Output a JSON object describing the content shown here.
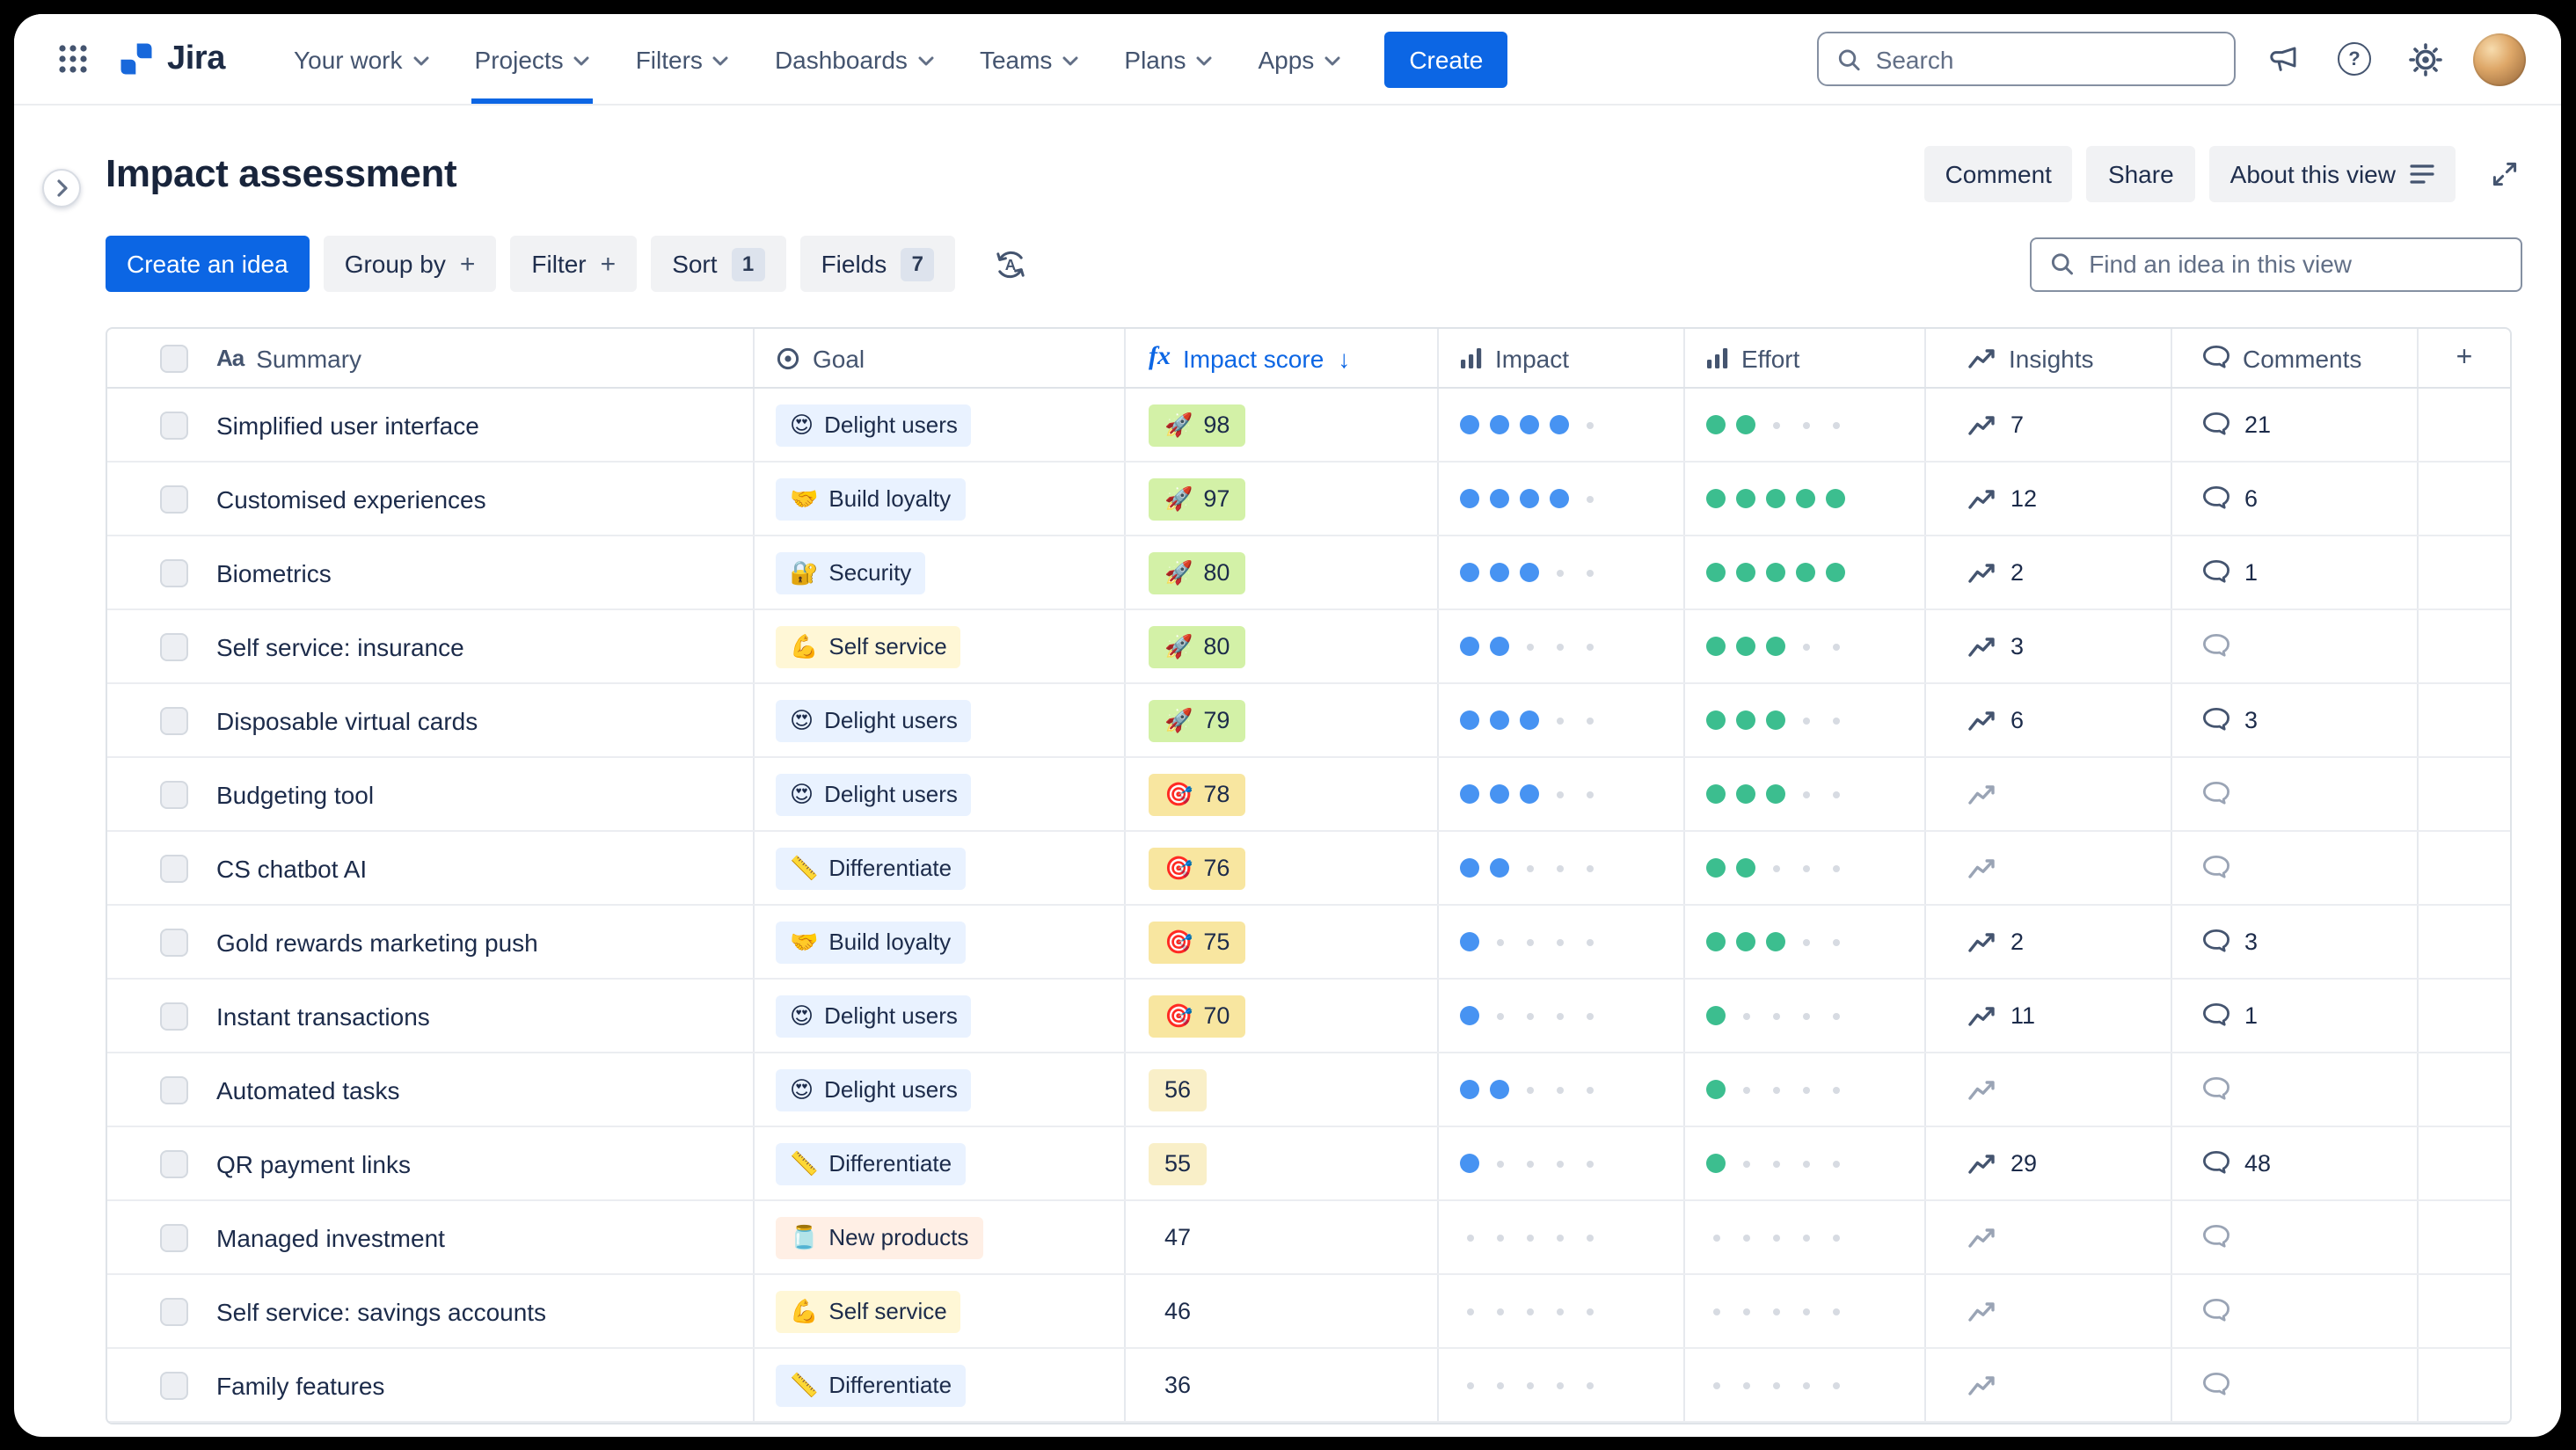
{
  "colors": {
    "accent_blue": "#0C66E4",
    "impact_dot": "#4793F2",
    "effort_dot": "#3CBE8F",
    "empty_dot": "#D7DBE2",
    "score_tones": {
      "green": "#D3F1A7",
      "yellow": "#F8E6A0",
      "pale": "#F9EFC8",
      "none": "transparent"
    }
  },
  "icons": {
    "summary_type": "Aa",
    "formula": "fx",
    "sort_desc": "↓",
    "plus": "+",
    "question": "?"
  },
  "topnav": {
    "product_name": "Jira",
    "nav_items": [
      {
        "label": "Your work"
      },
      {
        "label": "Projects",
        "active": true
      },
      {
        "label": "Filters"
      },
      {
        "label": "Dashboards"
      },
      {
        "label": "Teams"
      },
      {
        "label": "Plans"
      },
      {
        "label": "Apps"
      }
    ],
    "create_label": "Create",
    "search_placeholder": "Search"
  },
  "header": {
    "title": "Impact assessment",
    "comment_label": "Comment",
    "share_label": "Share",
    "about_label": "About this view"
  },
  "toolbar": {
    "create_idea_label": "Create an idea",
    "group_by_label": "Group by",
    "filter_label": "Filter",
    "sort_label": "Sort",
    "sort_count": "1",
    "fields_label": "Fields",
    "fields_count": "7",
    "find_placeholder": "Find an idea in this view"
  },
  "table": {
    "columns": {
      "summary": "Summary",
      "goal": "Goal",
      "impact_score": "Impact score",
      "impact": "Impact",
      "effort": "Effort",
      "insights": "Insights",
      "comments": "Comments"
    },
    "goals": {
      "Delight users": {
        "emoji": "😍",
        "bg": "#E9F2FF"
      },
      "Build loyalty": {
        "emoji": "🤝",
        "bg": "#E9F2FF"
      },
      "Security": {
        "emoji": "🔐",
        "bg": "#E9F2FF"
      },
      "Self service": {
        "emoji": "💪",
        "bg": "#FFF7D6"
      },
      "Differentiate": {
        "emoji": "📏",
        "bg": "#E9F2FF"
      },
      "New products": {
        "emoji": "🫙",
        "bg": "#FFEFE5"
      }
    },
    "rows": [
      {
        "summary": "Simplified user interface",
        "goal": "Delight users",
        "score": {
          "value": "98",
          "emoji": "🚀",
          "tone": "green"
        },
        "impact": 4,
        "effort": 2,
        "insights": "7",
        "comments": "21"
      },
      {
        "summary": "Customised experiences",
        "goal": "Build loyalty",
        "score": {
          "value": "97",
          "emoji": "🚀",
          "tone": "green"
        },
        "impact": 4,
        "effort": 5,
        "insights": "12",
        "comments": "6"
      },
      {
        "summary": "Biometrics",
        "goal": "Security",
        "score": {
          "value": "80",
          "emoji": "🚀",
          "tone": "green"
        },
        "impact": 3,
        "effort": 5,
        "insights": "2",
        "comments": "1"
      },
      {
        "summary": "Self service: insurance",
        "goal": "Self service",
        "score": {
          "value": "80",
          "emoji": "🚀",
          "tone": "green"
        },
        "impact": 2,
        "effort": 3,
        "insights": "3",
        "comments": ""
      },
      {
        "summary": "Disposable virtual cards",
        "goal": "Delight users",
        "score": {
          "value": "79",
          "emoji": "🚀",
          "tone": "green"
        },
        "impact": 3,
        "effort": 3,
        "insights": "6",
        "comments": "3"
      },
      {
        "summary": "Budgeting tool",
        "goal": "Delight users",
        "score": {
          "value": "78",
          "emoji": "🎯",
          "tone": "yellow"
        },
        "impact": 3,
        "effort": 3,
        "insights": "",
        "comments": ""
      },
      {
        "summary": "CS chatbot AI",
        "goal": "Differentiate",
        "score": {
          "value": "76",
          "emoji": "🎯",
          "tone": "yellow"
        },
        "impact": 2,
        "effort": 2,
        "insights": "",
        "comments": ""
      },
      {
        "summary": "Gold rewards marketing push",
        "goal": "Build loyalty",
        "score": {
          "value": "75",
          "emoji": "🎯",
          "tone": "yellow"
        },
        "impact": 1,
        "effort": 3,
        "insights": "2",
        "comments": "3"
      },
      {
        "summary": "Instant transactions",
        "goal": "Delight users",
        "score": {
          "value": "70",
          "emoji": "🎯",
          "tone": "yellow"
        },
        "impact": 1,
        "effort": 1,
        "insights": "11",
        "comments": "1"
      },
      {
        "summary": "Automated tasks",
        "goal": "Delight users",
        "score": {
          "value": "56",
          "emoji": "",
          "tone": "pale"
        },
        "impact": 2,
        "effort": 1,
        "insights": "",
        "comments": ""
      },
      {
        "summary": "QR payment links",
        "goal": "Differentiate",
        "score": {
          "value": "55",
          "emoji": "",
          "tone": "pale"
        },
        "impact": 1,
        "effort": 1,
        "insights": "29",
        "comments": "48"
      },
      {
        "summary": "Managed investment",
        "goal": "New products",
        "score": {
          "value": "47",
          "emoji": "",
          "tone": "none"
        },
        "impact": 0,
        "effort": 0,
        "insights": "",
        "comments": ""
      },
      {
        "summary": "Self service: savings accounts",
        "goal": "Self service",
        "score": {
          "value": "46",
          "emoji": "",
          "tone": "none"
        },
        "impact": 0,
        "effort": 0,
        "insights": "",
        "comments": ""
      },
      {
        "summary": "Family features",
        "goal": "Differentiate",
        "score": {
          "value": "36",
          "emoji": "",
          "tone": "none"
        },
        "impact": 0,
        "effort": 0,
        "insights": "",
        "comments": ""
      }
    ]
  }
}
